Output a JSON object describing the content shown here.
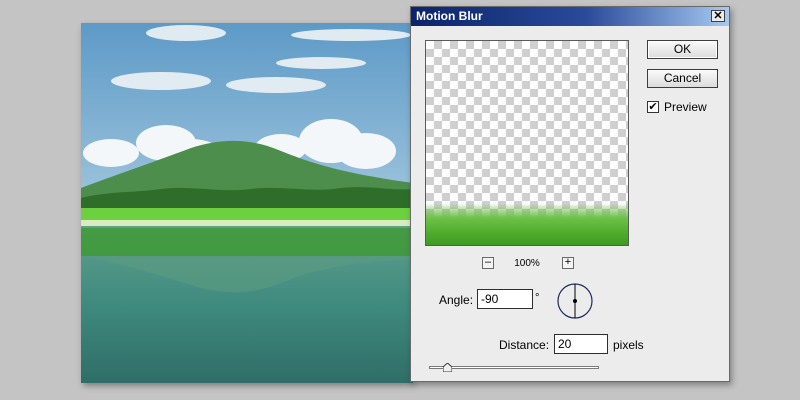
{
  "dialog": {
    "title": "Motion Blur",
    "close_label": "✕",
    "ok_label": "OK",
    "cancel_label": "Cancel",
    "preview_checkbox": {
      "label": "Preview",
      "checked": true,
      "check_glyph": "✔"
    },
    "zoom": {
      "out_label": "–",
      "in_label": "+",
      "level": "100%"
    },
    "angle": {
      "label": "Angle:",
      "value": "-90",
      "unit": "°"
    },
    "distance": {
      "label": "Distance:",
      "value": "20",
      "unit": "pixels"
    },
    "distance_slider": {
      "min": 1,
      "max": 999,
      "value": 20
    }
  },
  "colors": {
    "titlebar_start": "#0a246a",
    "titlebar_end": "#a6caf0",
    "dialog_bg": "#ececec",
    "grass": "#4fad2d",
    "water": "#3f8a7e"
  },
  "icons": {
    "close": "close-icon",
    "angle_dial": "angle-dial-icon",
    "slider_thumb": "slider-thumb-icon",
    "checkbox": "checkmark-icon"
  }
}
